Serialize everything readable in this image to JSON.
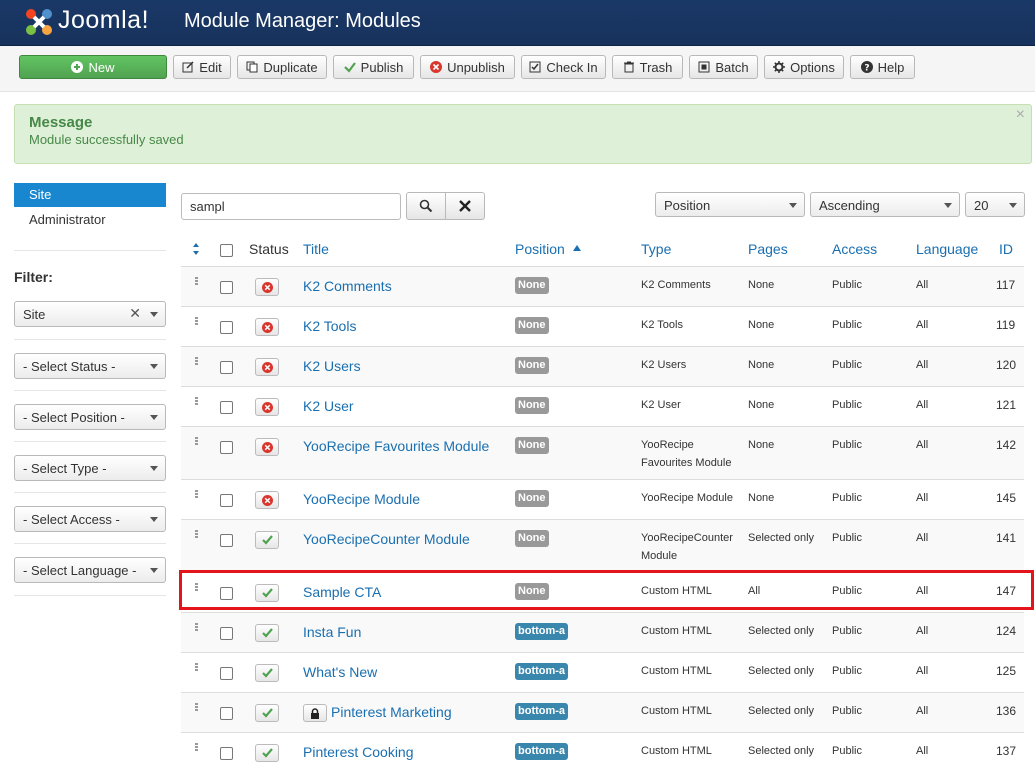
{
  "header": {
    "logo_text": "Joomla!",
    "page_title": "Module Manager: Modules",
    "bg_color": "#1a3867"
  },
  "toolbar": {
    "new": "New",
    "edit": "Edit",
    "duplicate": "Duplicate",
    "publish": "Publish",
    "unpublish": "Unpublish",
    "checkin": "Check In",
    "trash": "Trash",
    "batch": "Batch",
    "options": "Options",
    "help": "Help"
  },
  "message": {
    "heading": "Message",
    "body": "Module successfully saved",
    "close": "×"
  },
  "sidebar": {
    "site": "Site",
    "administrator": "Administrator",
    "filter_label": "Filter:",
    "client_filter": "Site",
    "status_filter": "- Select Status -",
    "position_filter": "- Select Position -",
    "type_filter": "- Select Type -",
    "access_filter": "- Select Access -",
    "language_filter": "- Select Language -"
  },
  "search": {
    "value": "sampl"
  },
  "list_controls": {
    "sort_by": "Position",
    "direction": "Ascending",
    "limit": "20"
  },
  "table": {
    "headers": {
      "status": "Status",
      "title": "Title",
      "position": "Position",
      "type": "Type",
      "pages": "Pages",
      "access": "Access",
      "language": "Language",
      "id": "ID"
    },
    "rows": [
      {
        "published": false,
        "title": "K2 Comments",
        "position": "None",
        "type": "K2 Comments",
        "type2": "",
        "pages": "None",
        "access": "Public",
        "language": "All",
        "id": "117"
      },
      {
        "published": false,
        "title": "K2 Tools",
        "position": "None",
        "type": "K2 Tools",
        "type2": "",
        "pages": "None",
        "access": "Public",
        "language": "All",
        "id": "119"
      },
      {
        "published": false,
        "title": "K2 Users",
        "position": "None",
        "type": "K2 Users",
        "type2": "",
        "pages": "None",
        "access": "Public",
        "language": "All",
        "id": "120"
      },
      {
        "published": false,
        "title": "K2 User",
        "position": "None",
        "type": "K2 User",
        "type2": "",
        "pages": "None",
        "access": "Public",
        "language": "All",
        "id": "121"
      },
      {
        "published": false,
        "title": "YooRecipe Favourites Module",
        "position": "None",
        "type": "YooRecipe",
        "type2": "Favourites Module",
        "pages": "None",
        "access": "Public",
        "language": "All",
        "id": "142"
      },
      {
        "published": false,
        "title": "YooRecipe Module",
        "position": "None",
        "type": "YooRecipe Module",
        "type2": "",
        "pages": "None",
        "access": "Public",
        "language": "All",
        "id": "145"
      },
      {
        "published": true,
        "title": "YooRecipeCounter Module",
        "position": "None",
        "type": "YooRecipeCounter",
        "type2": "Module",
        "pages": "Selected only",
        "access": "Public",
        "language": "All",
        "id": "141"
      },
      {
        "published": true,
        "title": "Sample CTA",
        "position": "None",
        "type": "Custom HTML",
        "type2": "",
        "pages": "All",
        "access": "Public",
        "language": "All",
        "id": "147"
      },
      {
        "published": true,
        "title": "Insta Fun",
        "position": "bottom-a",
        "type": "Custom HTML",
        "type2": "",
        "pages": "Selected only",
        "access": "Public",
        "language": "All",
        "id": "124"
      },
      {
        "published": true,
        "title": "What's New",
        "position": "bottom-a",
        "type": "Custom HTML",
        "type2": "",
        "pages": "Selected only",
        "access": "Public",
        "language": "All",
        "id": "125"
      },
      {
        "published": true,
        "title": "Pinterest Marketing",
        "position": "bottom-a",
        "type": "Custom HTML",
        "type2": "",
        "pages": "Selected only",
        "access": "Public",
        "language": "All",
        "id": "136",
        "locked": true
      },
      {
        "published": true,
        "title": "Pinterest Cooking",
        "position": "bottom-a",
        "type": "Custom HTML",
        "type2": "",
        "pages": "Selected only",
        "access": "Public",
        "language": "All",
        "id": "137"
      }
    ]
  },
  "colors": {
    "link": "#1a6fb0",
    "success": "#62c462",
    "highlight": "#e3151b",
    "badge_blue": "#3a87ad",
    "badge_none": "#999999"
  }
}
